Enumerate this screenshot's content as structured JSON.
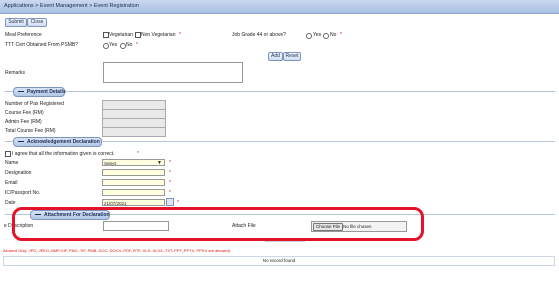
{
  "breadcrumb": "Applications > Event Management > Event Registration",
  "toolbar": {
    "submit_label": "Submit",
    "close_label": "Close"
  },
  "form": {
    "meal_preference_label": "Meal Preference",
    "meal_options": [
      "Vegetarian",
      "Non Vegetarian"
    ],
    "job_grade_label": "Job Grade 44 or above?",
    "yes_label": "Yes",
    "no_label": "No",
    "ttt_label": "TTT Cert Obtained From PSMB?",
    "add_label": "Add",
    "reset_label": "Reset",
    "remarks_label": "Remarks",
    "remarks_value": ""
  },
  "payment": {
    "title": "Payment Details",
    "fields": [
      "Number of Pax Registered",
      "Course Fee (RM)",
      "Admin Fee (RM)",
      "Total Course Fee (RM)"
    ]
  },
  "acknowledgement": {
    "title": "Acknowledgement Declaration",
    "agree_label": "I agree that all the information given is correct.",
    "name_label": "Name",
    "name_select_value": "Select",
    "designation_label": "Designation",
    "email_label": "Email",
    "ic_label": "IC/Passport No.",
    "date_label": "Date",
    "date_value": "21/07/2021"
  },
  "attachment": {
    "title": "Attachment For Declaration",
    "description_label": "e Description",
    "attach_label": "Attach File",
    "choose_file_label": "Choose File",
    "no_file_text": "No file chosen",
    "allowed_note": "Allowed Only: JPG,.JPEG,.BMP,GIF,.PNG,.TIF,.PMB,.DOC,.DOCX,.PDF,.RTF,.XLS,.XLSX,.TXT,.PPT,.PPTX,.PPSX are allowed)",
    "no_record_text": "No record found"
  },
  "colors": {
    "required": "#dd1111",
    "highlight": "#e3142a",
    "header": "#a9c0e2"
  }
}
